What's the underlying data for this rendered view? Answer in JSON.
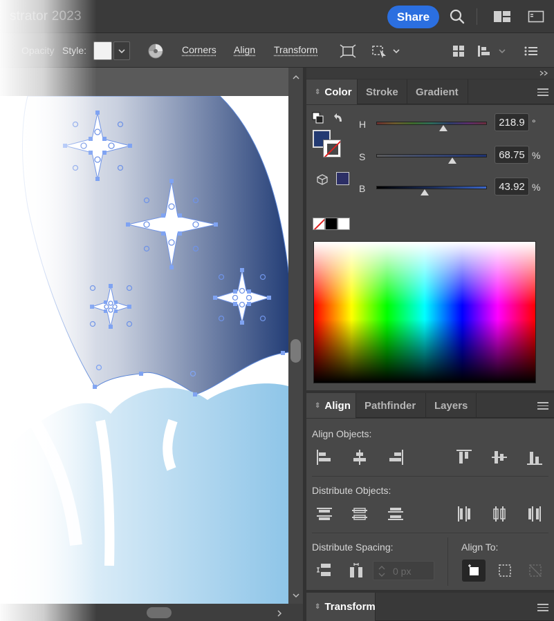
{
  "app": {
    "title": "strator 2023"
  },
  "header": {
    "share_label": "Share"
  },
  "control_bar": {
    "opacity_label": "Opacity",
    "style_label": "Style:",
    "corners_label": "Corners",
    "align_label": "Align",
    "transform_label": "Transform"
  },
  "color_panel": {
    "tabs": [
      "Color",
      "Stroke",
      "Gradient"
    ],
    "active_tab": "Color",
    "h": {
      "label": "H",
      "value": "218.9",
      "unit": "°",
      "fraction": 0.608
    },
    "s": {
      "label": "S",
      "value": "68.75",
      "unit": "%",
      "fraction": 0.6875
    },
    "b": {
      "label": "B",
      "value": "43.92",
      "unit": "%",
      "fraction": 0.4392
    },
    "fill_color": "#233a72",
    "gamut_swatch_color": "#2c2f66"
  },
  "align_panel": {
    "tabs": [
      "Align",
      "Pathfinder",
      "Layers"
    ],
    "active_tab": "Align",
    "align_objects_label": "Align Objects:",
    "distribute_objects_label": "Distribute Objects:",
    "distribute_spacing_label": "Distribute Spacing:",
    "align_to_label": "Align To:",
    "spacing_placeholder": "0 px"
  },
  "transform_panel": {
    "title": "Transform"
  },
  "icons": [
    "search-icon",
    "workspace-icon",
    "panel-toggle-icon",
    "recolor-icon",
    "crop-icon",
    "puppet-warp-icon",
    "align-menu-icon",
    "list-icon",
    "collapse-icon"
  ]
}
